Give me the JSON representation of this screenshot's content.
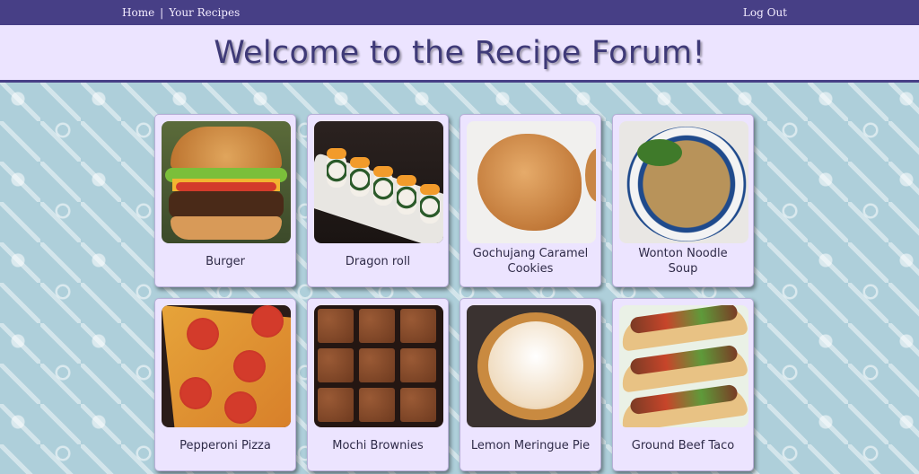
{
  "nav": {
    "home": "Home",
    "separator": "|",
    "your_recipes": "Your Recipes",
    "logout": "Log Out"
  },
  "hero": {
    "title": "Welcome to the Recipe Forum!"
  },
  "recipes": [
    {
      "title": "Burger",
      "icon": "burger-image"
    },
    {
      "title": "Dragon roll",
      "icon": "sushi-image"
    },
    {
      "title": "Gochujang Caramel Cookies",
      "icon": "cookie-image"
    },
    {
      "title": "Wonton Noodle Soup",
      "icon": "soup-image"
    },
    {
      "title": "Pepperoni Pizza",
      "icon": "pizza-image"
    },
    {
      "title": "Mochi Brownies",
      "icon": "brownie-image"
    },
    {
      "title": "Lemon Meringue Pie",
      "icon": "pie-image"
    },
    {
      "title": "Ground Beef Taco",
      "icon": "taco-image"
    }
  ],
  "colors": {
    "nav_bg": "#473f86",
    "hero_bg": "#ece4ff",
    "page_bg": "#aecfda",
    "card_bg": "#ece4ff",
    "title_text": "#3f3a78"
  }
}
